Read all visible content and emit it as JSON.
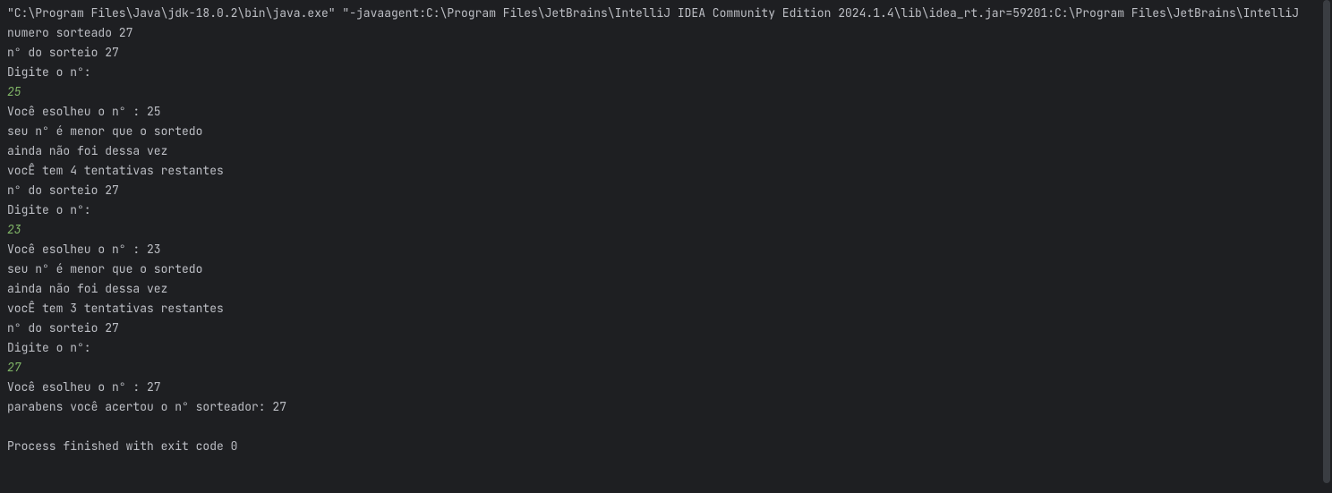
{
  "console": {
    "lines": [
      {
        "type": "output",
        "text": "\"C:\\Program Files\\Java\\jdk-18.0.2\\bin\\java.exe\" \"-javaagent:C:\\Program Files\\JetBrains\\IntelliJ IDEA Community Edition 2024.1.4\\lib\\idea_rt.jar=59201:C:\\Program Files\\JetBrains\\IntelliJ"
      },
      {
        "type": "output",
        "text": " numero sorteado 27"
      },
      {
        "type": "output",
        "text": "n° do sorteio 27"
      },
      {
        "type": "output",
        "text": "Digite o n°:"
      },
      {
        "type": "input",
        "text": "25"
      },
      {
        "type": "output",
        "text": " Você esolheu o n° : 25"
      },
      {
        "type": "output",
        "text": " seu n° é menor que o sortedo"
      },
      {
        "type": "output",
        "text": " ainda não foi dessa vez"
      },
      {
        "type": "output",
        "text": " vocÊ tem 4 tentativas restantes"
      },
      {
        "type": "output",
        "text": "n° do sorteio 27"
      },
      {
        "type": "output",
        "text": "Digite o n°:"
      },
      {
        "type": "input",
        "text": "23"
      },
      {
        "type": "output",
        "text": " Você esolheu o n° : 23"
      },
      {
        "type": "output",
        "text": " seu n° é menor que o sortedo"
      },
      {
        "type": "output",
        "text": " ainda não foi dessa vez"
      },
      {
        "type": "output",
        "text": " vocÊ tem 3 tentativas restantes"
      },
      {
        "type": "output",
        "text": "n° do sorteio 27"
      },
      {
        "type": "output",
        "text": "Digite o n°:"
      },
      {
        "type": "input",
        "text": "27"
      },
      {
        "type": "output",
        "text": " Você esolheu o n° : 27"
      },
      {
        "type": "output",
        "text": " parabens você acertou o n° sorteador: 27"
      }
    ],
    "exitMessage": "Process finished with exit code 0"
  }
}
